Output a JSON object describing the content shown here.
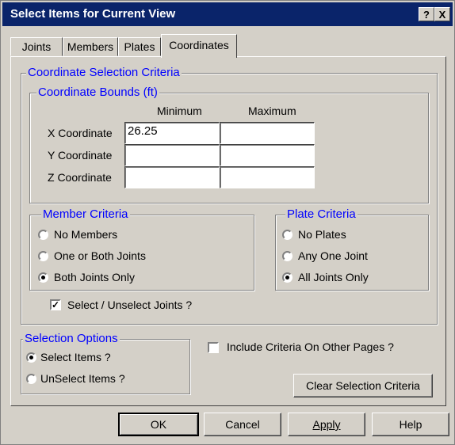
{
  "window": {
    "title": "Select Items for Current View",
    "help_label": "?",
    "close_label": "X"
  },
  "tabs": [
    "Joints",
    "Members",
    "Plates",
    "Coordinates"
  ],
  "coordinate_criteria": {
    "title": "Coordinate Selection Criteria",
    "bounds": {
      "title": "Coordinate Bounds  (ft)",
      "min_header": "Minimum",
      "max_header": "Maximum",
      "rows": [
        {
          "label": "X Coordinate",
          "min": "26.25",
          "max": ""
        },
        {
          "label": "Y Coordinate",
          "min": "",
          "max": ""
        },
        {
          "label": "Z Coordinate",
          "min": "",
          "max": ""
        }
      ]
    },
    "member_criteria": {
      "title": "Member Criteria",
      "options": [
        "No Members",
        "One or Both Joints",
        "Both Joints Only"
      ],
      "selected": "Both Joints Only"
    },
    "plate_criteria": {
      "title": "Plate Criteria",
      "options": [
        "No Plates",
        "Any One Joint",
        "All Joints Only"
      ],
      "selected": "All Joints Only"
    },
    "select_joints": {
      "label": "Select / Unselect Joints ?",
      "checked": true
    }
  },
  "selection_options": {
    "title": "Selection Options",
    "options": [
      "Select Items ?",
      "UnSelect Items ?"
    ],
    "selected": "Select Items ?"
  },
  "include_other_pages": {
    "label": "Include Criteria On Other Pages ?",
    "checked": false
  },
  "clear_button": "Clear Selection Criteria",
  "footer": {
    "ok": "OK",
    "cancel": "Cancel",
    "apply": "Apply",
    "help": "Help"
  }
}
